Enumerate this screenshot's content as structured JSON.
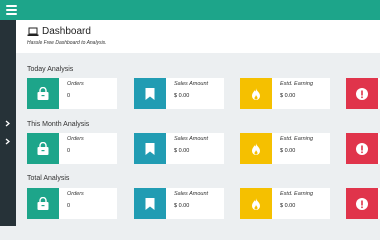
{
  "header": {
    "title": "Dashboard",
    "subtitle": "Hassle Free Dashboard to Analysis."
  },
  "sections": [
    {
      "title": "Today Analysis",
      "cards": [
        {
          "label": "Orders",
          "value": "0"
        },
        {
          "label": "Sales Amount",
          "value": "$ 0.00"
        },
        {
          "label": "Estd. Earning",
          "value": "$ 0.00"
        }
      ]
    },
    {
      "title": "This Month Analysis",
      "cards": [
        {
          "label": "Orders",
          "value": "0"
        },
        {
          "label": "Sales Amount",
          "value": "$ 0.00"
        },
        {
          "label": "Estd. Earning",
          "value": "$ 0.00"
        }
      ]
    },
    {
      "title": "Total Analysis",
      "cards": [
        {
          "label": "Orders",
          "value": "0"
        },
        {
          "label": "Sales Amount",
          "value": "$ 0.00"
        },
        {
          "label": "Estd. Earning",
          "value": "$ 0.00"
        }
      ]
    }
  ],
  "icons": {
    "menu": "menu-icon",
    "laptop": "laptop-icon",
    "orders": "shopping-bag-icon",
    "sales": "bookmark-icon",
    "earning": "fire-icon",
    "alert": "exclamation-icon",
    "sidebar_arrow": "chevron-right-icon"
  },
  "colors": {
    "topbar": "#1da58a",
    "sidebar": "#263238",
    "orders": "#1da58a",
    "sales": "#219cb3",
    "earning": "#f5c000",
    "alert": "#e0344b",
    "background": "#eceff1"
  }
}
